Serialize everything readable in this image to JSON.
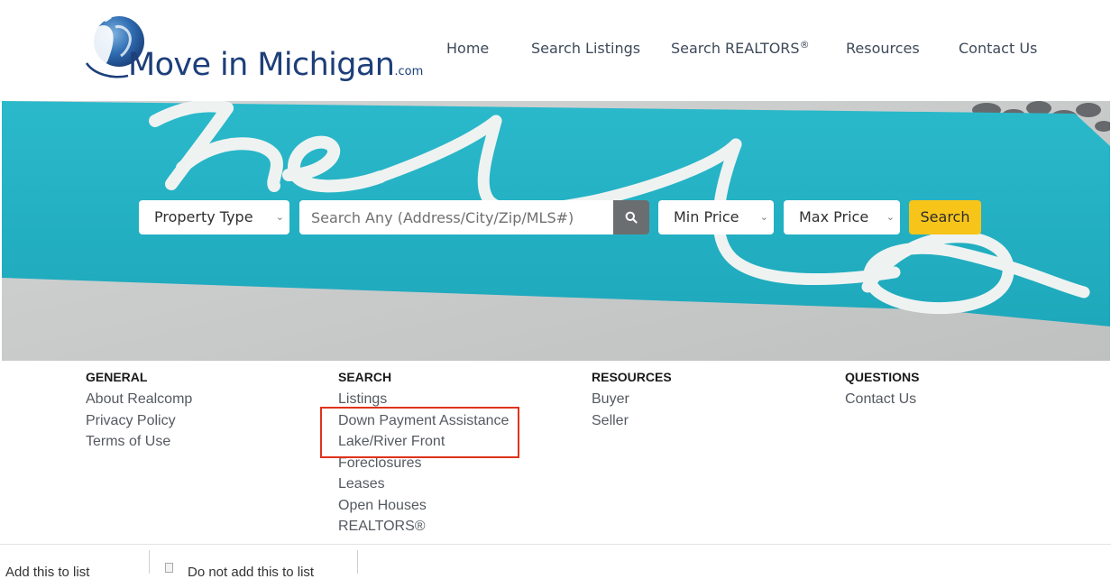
{
  "logo": {
    "text": "Move in Michigan",
    "suffix": ".com"
  },
  "nav": {
    "items": [
      {
        "label": "Home"
      },
      {
        "label": "Search Listings"
      },
      {
        "label": "Search REALTORS",
        "sup": "®"
      },
      {
        "label": "Resources"
      },
      {
        "label": "Contact Us"
      }
    ]
  },
  "hero": {
    "search": {
      "property_type": "Property Type",
      "input_placeholder": "Search Any (Address/City/Zip/MLS#)",
      "min_price": "Min Price",
      "max_price": "Max Price",
      "submit_label": "Search"
    },
    "colors": {
      "mat": "#25b5c7",
      "button": "#f7c41a",
      "search_icon_bg": "#6b6e71"
    }
  },
  "footer": {
    "general": {
      "heading": "GENERAL",
      "links": [
        "About Realcomp",
        "Privacy Policy",
        "Terms of Use"
      ]
    },
    "search": {
      "heading": "SEARCH",
      "links": [
        "Listings",
        "Down Payment Assistance",
        "Lake/River Front",
        "Foreclosures",
        "Leases",
        "Open Houses",
        "REALTORS®"
      ]
    },
    "resources": {
      "heading": "RESOURCES",
      "links": [
        "Buyer",
        "Seller"
      ]
    },
    "questions": {
      "heading": "QUESTIONS",
      "links": [
        "Contact Us"
      ]
    },
    "highlight_color": "#e0331c"
  },
  "bottom_strip": {
    "left_text": "Add this to list",
    "right_text": "Do not add this to list"
  }
}
